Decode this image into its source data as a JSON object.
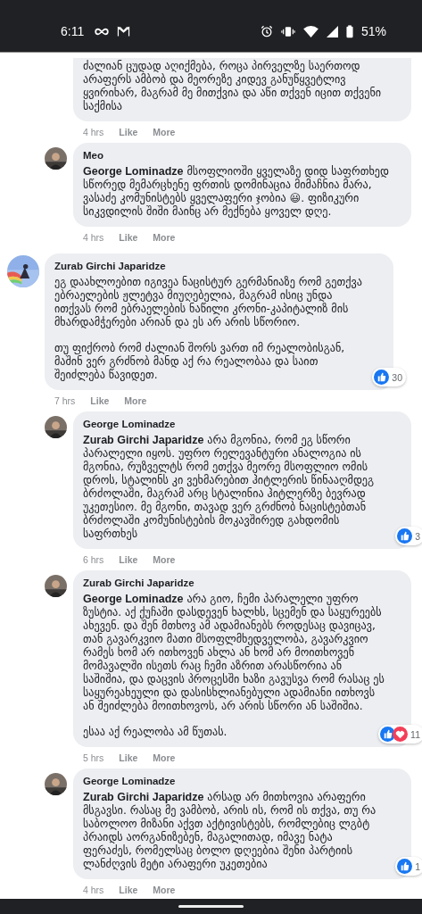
{
  "status_bar": {
    "time": "6:11",
    "battery": "51%"
  },
  "earlier_replies": [
    {
      "paragraphs": [
        "ძალიან ცუდად აღიქმება, როცა პირველზე საერთოდ არაფერს ამბობ და მეორეზე კიდევ განუწყვეტლივ ყვირიხარ, მაგრამ მე მითქვია და აწი თქვენ იცით თქვენი საქმისა"
      ],
      "time": "4 hrs",
      "like": "Like",
      "more": "More"
    },
    {
      "author": "Meo",
      "paragraphs": [
        "**George Lominadze** მსოფლიოში ყველაზე დიდ საფრთხედ სწორედ მემარცხენე ფრთის დომინაცია მიმაჩნია მარა, ვასაძე კომუნისტებს ყველაფერი ჯობია 😃. ფიზიკური სიკვდილის შიში მაინც არ მექნება ყოველ დღე."
      ],
      "time": "4 hrs",
      "like": "Like",
      "more": "More"
    }
  ],
  "thread": {
    "author": "Zurab Girchi Japaridze",
    "paragraphs": [
      "ეგ დაახლოებით იგივეა ნაცისტურ გერმანიაზე რომ გეთქვა ებრაელების ჟლეტვა მიუღებელია, მაგრამ ისიც უნდა ითქვას რომ ებრაელების ნაწილი კრონი-კაპიტალიზ მის მხარდამჭერები არიან და ეს არ არის სწორიო.",
      "თუ ფიქრობ რომ ძალიან შორს ვართ იმ რეალობისგან, მაშინ ვერ გრძნობ მანდ აქ რა რეალობაა და საით შეიძლება წავიდეთ."
    ],
    "reactions": {
      "like": true,
      "love": false,
      "count": "30"
    },
    "time": "7 hrs",
    "like": "Like",
    "more": "More",
    "children": [
      {
        "author": "George Lominadze",
        "paragraphs": [
          "**Zurab Girchi Japaridze** არა მგონია, რომ ეგ სწორი პარალელი იყოს. უფრო რელევანტური ანალოგია ის მგონია, რუზველტს რომ ეთქვა მეორე მსოფლიო ომის დროს, სტალინს კი ვეხმარებით ჰიტლერის წინააღმდეგ ბრძოლაში, მაგრამ არც სტალინია ჰიტლერზე ბევრად უკეთესიო. მე მგონი, თავად ვერ გრძნობ ნაცისტებთან ბრძოლაში კომუნისტების მოკავშირედ გახდომის საფრთხეს"
        ],
        "reactions": {
          "like": true,
          "love": false,
          "count": "3"
        },
        "time": "6 hrs",
        "like": "Like",
        "more": "More"
      },
      {
        "author": "Zurab Girchi Japaridze",
        "paragraphs": [
          "**George Lominadze** არა გიო, ჩემი პარალელი უფრო ზუსტია. აქ ქუჩაში დასდევენ ხალხს, სცემენ და საყურეებს ახევენ. და შენ მთხოვ ამ ადამიანებს როდესაც დავიცავ, თან გავარკვიო მათი მსოფლმხედველობა, გავარკვიო რამეს ხომ არ ითხოვენ ახლა ან ხომ არ მოითხოვენ მომავალში ისეთს რაც ჩემი აზრით არასწორია ან საშიშია, და დაცვის პროცესში ხაზი გავუსვა რომ რასაც ეს საყურეახეული და დასისხლიანებული ადამიანი ითხოვს ან შეიძლება მოითხოვოს, არ არის სწორი ან საშიშია.",
          "ესაა აქ რეალობა ამ წუთას."
        ],
        "reactions": {
          "like": true,
          "love": true,
          "count": "11"
        },
        "time": "5 hrs",
        "like": "Like",
        "more": "More"
      },
      {
        "author": "George Lominadze",
        "paragraphs": [
          "**Zurab Girchi Japaridze** არსად არ მითხოვია არაფერი მსგავსი. რასაც მე ვამბობ, არის ის, რომ ის თქვა, თუ რა საბოლოო მიზანი აქვთ აქტივისტებს, რომლებიც ლგბტ პრაიდს აორგანიზებენ, მაგალითად, იმავე ნატა ფერაძეს, რომელსაც ბოლო დღეებია შენი პარტიის ლანძღვის მეტი არაფერი უკეთებია"
        ],
        "reactions": {
          "like": true,
          "love": false,
          "count": "1"
        },
        "time": "4 hrs",
        "like": "Like",
        "more": "More"
      }
    ]
  }
}
